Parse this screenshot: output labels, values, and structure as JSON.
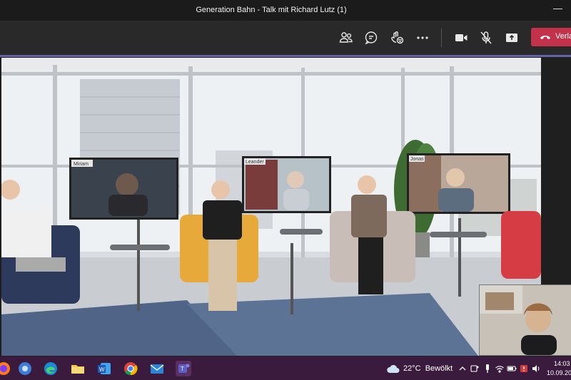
{
  "window": {
    "title": "Generation Bahn - Talk mit Richard Lutz (1)",
    "minimize_glyph": "—"
  },
  "toolbar": {
    "icons": [
      "participants-icon",
      "chat-icon",
      "reactions-icon",
      "more-icon",
      "camera-icon",
      "mic-off-icon",
      "share-icon"
    ],
    "leave_label": "Verla"
  },
  "screens": {
    "left_name": "Miriam",
    "center_name": "Leander",
    "right_name": "Jonas"
  },
  "taskbar": {
    "weather": {
      "temp": "22°C",
      "condition": "Bewölkt"
    },
    "time": "14:03",
    "date": "10.09.20"
  },
  "colors": {
    "accent": "#6264a7",
    "leave": "#c4314b",
    "taskbar": "#3a1b3d"
  }
}
